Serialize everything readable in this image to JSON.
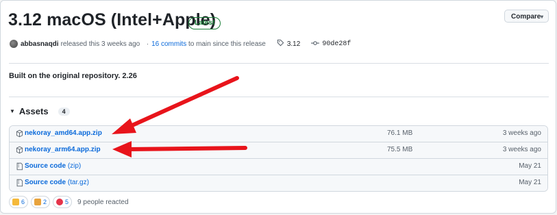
{
  "release": {
    "title": "3.12 macOS (Intel+Apple)",
    "badge": "Latest",
    "compare_label": "Compare",
    "author": "abbasnaqdi",
    "released_text": "released this 3 weeks ago",
    "commits_link": "16 commits",
    "commits_suffix": "to main since this release",
    "tag": "3.12",
    "commit_hash": "90de28f",
    "body": "Built on the original repository. 2.26"
  },
  "assets": {
    "heading": "Assets",
    "count": "4",
    "items": [
      {
        "name": "nekoray_amd64.app.zip",
        "ext": "",
        "size": "76.1 MB",
        "date": "3 weeks ago"
      },
      {
        "name": "nekoray_arm64.app.zip",
        "ext": "",
        "size": "75.5 MB",
        "date": "3 weeks ago"
      },
      {
        "name": "Source code",
        "ext": "(zip)",
        "size": "",
        "date": "May 21"
      },
      {
        "name": "Source code",
        "ext": "(tar.gz)",
        "size": "",
        "date": "May 21"
      }
    ]
  },
  "reactions": {
    "items": [
      {
        "icon": "thumbs-up-icon",
        "count": "6",
        "color": "#f5b93a"
      },
      {
        "icon": "party-icon",
        "count": "2",
        "color": "#e8a33d"
      },
      {
        "icon": "heart-icon",
        "count": "5",
        "color": "#e5344a"
      }
    ],
    "summary": "9 people reacted"
  },
  "colors": {
    "accent": "#0969da",
    "latest": "#1a7f37",
    "annotation_arrow": "#e8141b"
  }
}
